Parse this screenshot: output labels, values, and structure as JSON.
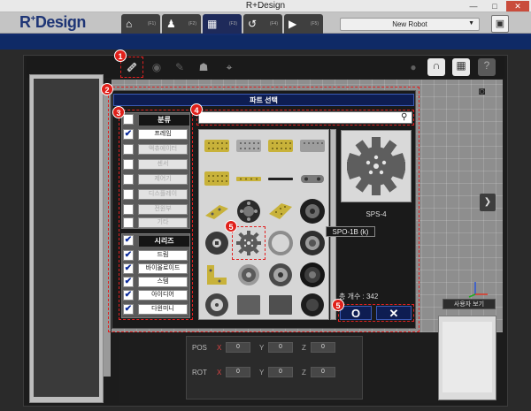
{
  "window": {
    "title": "R+Design",
    "minimize": "—",
    "maximize": "□",
    "close": "✕"
  },
  "app": {
    "logo_main": "R",
    "logo_sup": "+",
    "logo_rest": "Design",
    "tabs": [
      {
        "icon": "⌂",
        "key": "(F1)"
      },
      {
        "icon": "♟",
        "key": "(F2)"
      },
      {
        "icon": "▦",
        "key": "(F3)"
      },
      {
        "icon": "↺",
        "key": "(F4)"
      },
      {
        "icon": "▶",
        "key": "(F5)"
      }
    ],
    "robot_select": "New Robot",
    "save_icon": "▣"
  },
  "toolbar": {
    "icons": [
      "parts-icon",
      "paint-icon",
      "brush-icon",
      "robot-icon",
      "focus-icon",
      "magnet-icon",
      "grid-icon",
      "help-icon"
    ]
  },
  "dialog": {
    "title": "파트 선택",
    "search_placeholder": "",
    "category_head": "분류",
    "categories": [
      {
        "label": "프레임",
        "checked": true,
        "enabled": true
      },
      {
        "label": "액츄에이터",
        "checked": false,
        "enabled": false
      },
      {
        "label": "센서",
        "checked": false,
        "enabled": false
      },
      {
        "label": "제어기",
        "checked": false,
        "enabled": false
      },
      {
        "label": "디스플레이",
        "checked": false,
        "enabled": false
      },
      {
        "label": "전원부",
        "checked": false,
        "enabled": false
      },
      {
        "label": "기타",
        "checked": false,
        "enabled": false
      }
    ],
    "series_head": "시리즈",
    "series": [
      {
        "label": "드림",
        "checked": true
      },
      {
        "label": "바이올로이드",
        "checked": true
      },
      {
        "label": "스템",
        "checked": true
      },
      {
        "label": "아이디어",
        "checked": true
      },
      {
        "label": "다윈미니",
        "checked": true
      }
    ],
    "preview_name": "SPS-4",
    "tooltip": "SPO-1B (k)",
    "count_label": "총 개수 : 342",
    "ok_label": "O",
    "cancel_label": "✕"
  },
  "markers": [
    "1",
    "2",
    "3",
    "4",
    "5",
    "5",
    "5"
  ],
  "view": {
    "user_view": "사용자 보기"
  },
  "props": {
    "pos_label": "POS",
    "rot_label": "ROT",
    "x": "X",
    "y": "Y",
    "z": "Z",
    "pos_values": [
      "0",
      "0",
      "0"
    ],
    "rot_values": [
      "0",
      "0",
      "0"
    ]
  },
  "colors": {
    "accent": "#0e1d52",
    "highlight": "#e02020",
    "checkmark": "#0a2a9a"
  }
}
